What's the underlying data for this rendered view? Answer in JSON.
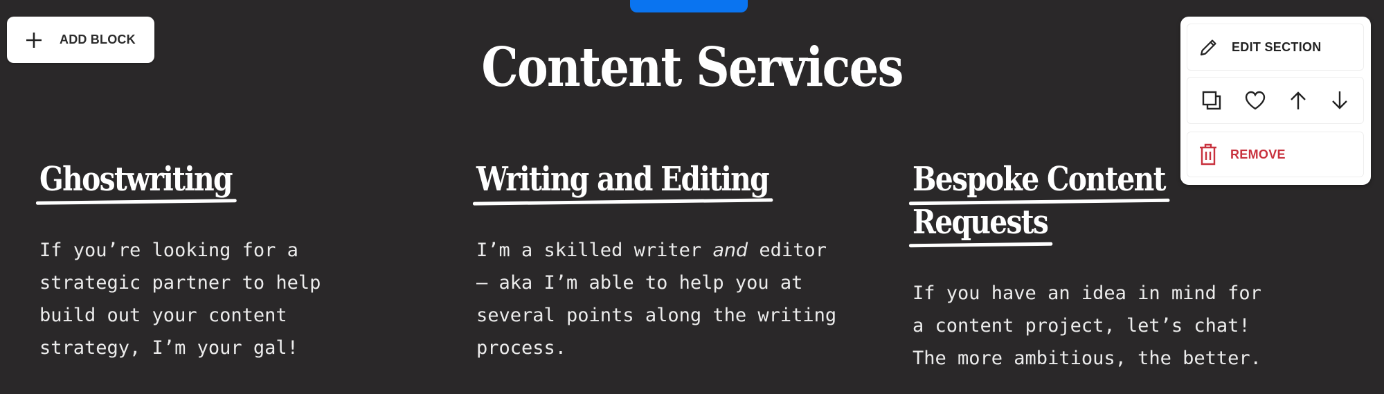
{
  "toolbar": {
    "add_block_label": "ADD BLOCK",
    "top_tab_color": "#0a74f0"
  },
  "section": {
    "title": "Content Services",
    "columns": [
      {
        "heading_lines": [
          "Ghostwriting"
        ],
        "body": "If you’re looking for a\nstrategic partner to help\nbuild out your content\nstrategy, I’m your gal!"
      },
      {
        "heading_lines": [
          "Writing and Editing"
        ],
        "body_before": "I’m a skilled writer ",
        "body_em": "and",
        "body_after": " editor\n— aka I’m able to help you at\nseveral points along the writing\nprocess."
      },
      {
        "heading_lines": [
          "Bespoke Content",
          "Requests"
        ],
        "body": "If you have an idea in mind for\na content project, let’s chat!\nThe more ambitious, the better."
      }
    ]
  },
  "section_menu": {
    "edit_label": "EDIT SECTION",
    "edit_icon": "pencil-icon",
    "actions": [
      "duplicate-icon",
      "heart-icon",
      "arrow-up-icon",
      "arrow-down-icon"
    ],
    "remove_label": "REMOVE",
    "remove_icon": "trash-icon",
    "remove_color": "#c8313d"
  }
}
